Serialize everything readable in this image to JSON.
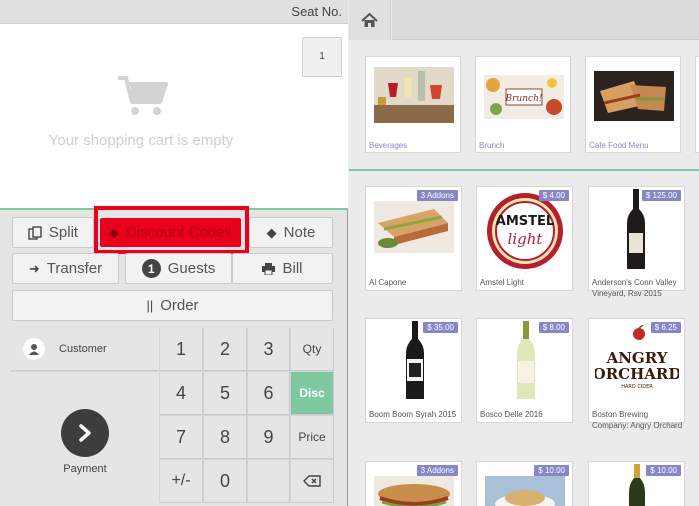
{
  "cart": {
    "seat_label": "Seat No.",
    "seat_number": "1",
    "empty_text": "Your shopping cart is empty"
  },
  "actions": {
    "split": "Split",
    "discount_codes": "Discount Codes",
    "note": "Note",
    "transfer": "Transfer",
    "guests_count": "1",
    "guests": "Guests",
    "bill": "Bill",
    "order": "Order"
  },
  "keypad": {
    "customer": "Customer",
    "payment": "Payment",
    "k1": "1",
    "k2": "2",
    "k3": "3",
    "k4": "4",
    "k5": "5",
    "k6": "6",
    "k7": "7",
    "k8": "8",
    "k9": "9",
    "kpm": "+/-",
    "k0": "0",
    "qty": "Qty",
    "disc": "Disc",
    "price": "Price",
    "backspace_icon": "backspace-icon"
  },
  "categories": [
    {
      "label": "Beverages"
    },
    {
      "label": "Brunch"
    },
    {
      "label": "Cafe Food Menu"
    }
  ],
  "products": [
    {
      "name": "Al Capone",
      "badge": "3 Addons"
    },
    {
      "name": "Amstel Light",
      "badge": "$ 4.00"
    },
    {
      "name": "Anderson's Conn Valley Vineyard, Rsv 2015",
      "badge": "$ 125.00"
    },
    {
      "name": "Boom Boom Syrah 2015",
      "badge": "$ 35.00"
    },
    {
      "name": "Bosco Delle 2016",
      "badge": "$ 8.00"
    },
    {
      "name": "Boston Brewing Company: Angry Orchard",
      "badge": "$ 6.25"
    },
    {
      "name": "",
      "badge": "3 Addons"
    },
    {
      "name": "",
      "badge": "$ 10.00"
    },
    {
      "name": "",
      "badge": "$ 10.00"
    }
  ],
  "logos": {
    "amstel_line1": "AMSTEL",
    "amstel_line2": "light",
    "angry_line1": "ANGRY",
    "angry_line2": "ORCHARD",
    "angry_line3": "HARD CIDER",
    "brunch_sign": "Brunch!"
  },
  "colors": {
    "accent_green": "#7ec9a1",
    "badge_purple": "#8687c8",
    "highlight_red": "#e8001c"
  }
}
